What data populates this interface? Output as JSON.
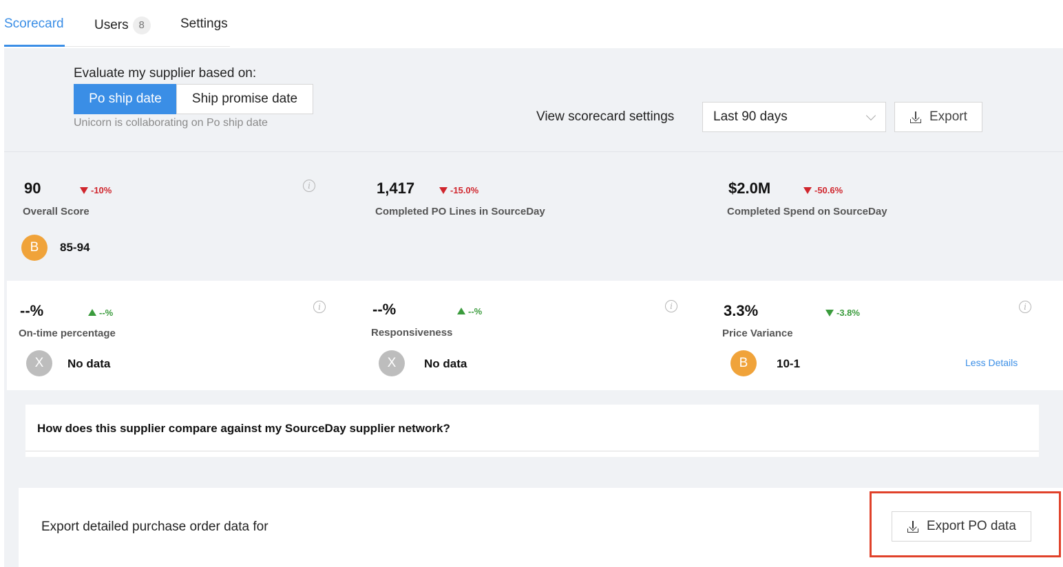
{
  "tabs": [
    {
      "label": "Scorecard",
      "active": true
    },
    {
      "label": "Users",
      "badge": "8"
    },
    {
      "label": "Settings"
    }
  ],
  "evaluation": {
    "label": "Evaluate my supplier based on:",
    "options": [
      "Po ship date",
      "Ship promise date"
    ],
    "selected": "Po ship date",
    "note": "Unicorn is collaborating on Po ship date"
  },
  "controls": {
    "view_settings": "View scorecard settings",
    "date_range": "Last 90 days",
    "export_label": "Export"
  },
  "metrics_top": [
    {
      "value": "90",
      "delta": "-10%",
      "label": "Overall Score",
      "grade": "B",
      "range": "85-94"
    },
    {
      "value": "1,417",
      "delta": "-15.0%",
      "label": "Completed PO Lines in SourceDay"
    },
    {
      "value": "$2.0M",
      "delta": "-50.6%",
      "label": "Completed Spend on SourceDay"
    }
  ],
  "metrics_bottom": [
    {
      "value": "--%",
      "delta": "--%",
      "label": "On-time percentage",
      "grade": "X",
      "range": "No data"
    },
    {
      "value": "--%",
      "delta": "--%",
      "label": "Responsiveness",
      "grade": "X",
      "range": "No data"
    },
    {
      "value": "3.3%",
      "delta": "-3.8%",
      "label": "Price Variance",
      "grade": "B",
      "range": "10-1"
    }
  ],
  "less_details": "Less Details",
  "compare_question": "How does this supplier compare against my SourceDay supplier network?",
  "export_section": {
    "text": "Export detailed purchase order data for",
    "button": "Export PO data"
  },
  "colors": {
    "accent": "#3a8ee6",
    "negative": "#d0262d",
    "positive": "#3a9b3c",
    "grade_b": "#f0a33a",
    "grade_x": "#bdbdbd",
    "highlight": "#e0412a"
  }
}
